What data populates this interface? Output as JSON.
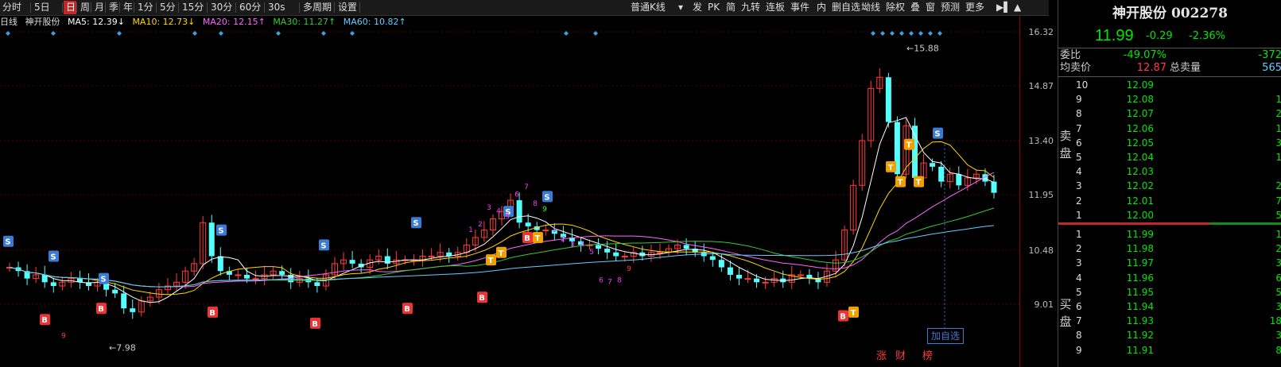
{
  "toolbar": {
    "items": [
      "分时",
      "5日",
      "日",
      "周",
      "月",
      "季",
      "年",
      "1分",
      "5分",
      "15分",
      "30分",
      "60分",
      "30s",
      "多周期",
      "设置"
    ],
    "kline_type": "普通K线",
    "right_items": [
      "发",
      "PK",
      "简",
      "九转",
      "连板",
      "事件",
      "内",
      "删自选",
      "坳线",
      "除权",
      "叠",
      "窗",
      "预测",
      "更多"
    ]
  },
  "ma": {
    "prefix": "日线",
    "stock": "神开股份",
    "ma5": "MA5: 12.39↓",
    "ma10": "MA10: 12.73↓",
    "ma20": "MA20: 12.15↑",
    "ma30": "MA30: 11.27↑",
    "ma60": "MA60: 10.82↑",
    "colors": {
      "ma5": "#ffffff",
      "ma10": "#ffd700",
      "ma20": "#ff66ff",
      "ma30": "#33cc33",
      "ma60": "#66ccff"
    }
  },
  "axis": {
    "labels": [
      "16.32",
      "14.87",
      "13.40",
      "11.95",
      "10.48",
      "9.01"
    ]
  },
  "chart": {
    "high_label": "←15.88",
    "low_label": "←7.98",
    "add_watch": "加自选",
    "footer": [
      "涨",
      "财",
      "榜"
    ],
    "nine_labels": [
      "1",
      "2",
      "3",
      "4",
      "5",
      "6",
      "7",
      "8",
      "9",
      "1",
      "2",
      "3",
      "4",
      "5",
      "6",
      "7",
      "8",
      "9",
      "9"
    ]
  },
  "quote": {
    "title": "神开股份 002278",
    "price": "11.99",
    "change": "-0.29",
    "pct": "-2.36%",
    "weibi_label": "委比",
    "weibi": "-49.07%",
    "weibi_diff": "-372",
    "avg_label": "均卖价",
    "avg": "12.87",
    "total_label": "总卖量",
    "total": "565",
    "sell_label": "卖\n盘",
    "buy_label": "买\n盘",
    "sell": [
      {
        "lv": "10",
        "price": "12.09",
        "vol": ""
      },
      {
        "lv": "9",
        "price": "12.08",
        "vol": "1"
      },
      {
        "lv": "8",
        "price": "12.07",
        "vol": "2"
      },
      {
        "lv": "7",
        "price": "12.06",
        "vol": "1"
      },
      {
        "lv": "6",
        "price": "12.05",
        "vol": "3"
      },
      {
        "lv": "5",
        "price": "12.04",
        "vol": "1"
      },
      {
        "lv": "4",
        "price": "12.03",
        "vol": ""
      },
      {
        "lv": "3",
        "price": "12.02",
        "vol": "2"
      },
      {
        "lv": "2",
        "price": "12.01",
        "vol": "7"
      },
      {
        "lv": "1",
        "price": "12.00",
        "vol": "5"
      }
    ],
    "buy": [
      {
        "lv": "1",
        "price": "11.99",
        "vol": "1"
      },
      {
        "lv": "2",
        "price": "11.98",
        "vol": "2"
      },
      {
        "lv": "3",
        "price": "11.97",
        "vol": "3"
      },
      {
        "lv": "4",
        "price": "11.96",
        "vol": "6"
      },
      {
        "lv": "5",
        "price": "11.95",
        "vol": "5"
      },
      {
        "lv": "6",
        "price": "11.94",
        "vol": "3"
      },
      {
        "lv": "7",
        "price": "11.93",
        "vol": "18"
      },
      {
        "lv": "8",
        "price": "11.92",
        "vol": "3"
      },
      {
        "lv": "9",
        "price": "11.91",
        "vol": "8"
      }
    ]
  }
}
